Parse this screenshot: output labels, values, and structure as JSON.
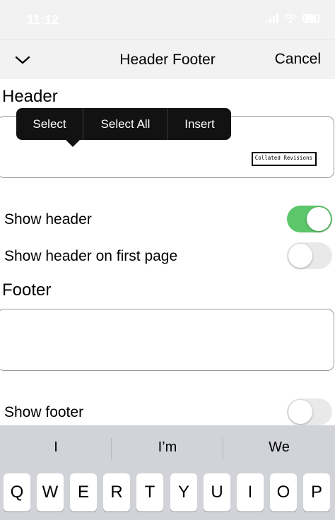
{
  "status_bar": {
    "time": "11:12"
  },
  "nav": {
    "title": "Header Footer",
    "cancel_label": "Cancel"
  },
  "header_section": {
    "label": "Header",
    "preview_text": "Collated Revisions"
  },
  "edit_menu": {
    "items": [
      "Select",
      "Select All",
      "Insert"
    ]
  },
  "settings": {
    "show_header": {
      "label": "Show header",
      "on": true
    },
    "show_header_first_page": {
      "label": "Show header on first page",
      "on": false
    },
    "show_footer": {
      "label": "Show footer",
      "on": false
    }
  },
  "footer_section": {
    "label": "Footer"
  },
  "keyboard": {
    "predictions": [
      "I",
      "I’m",
      "We"
    ],
    "keys": [
      "Q",
      "W",
      "E",
      "R",
      "T",
      "Y",
      "U",
      "I",
      "O",
      "P"
    ]
  },
  "colors": {
    "toggle_on": "#5cc66a",
    "toggle_off": "#e9e9ea",
    "menu_bg": "#121212",
    "keyboard_bg": "#d1d3d9"
  }
}
